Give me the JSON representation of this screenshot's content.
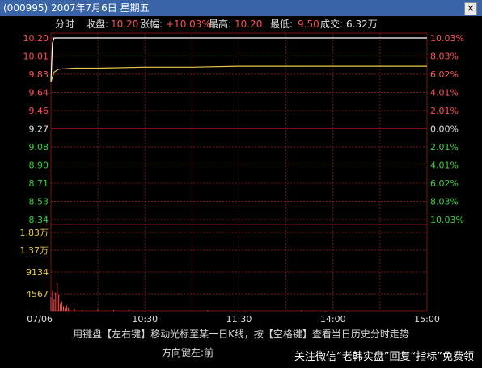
{
  "window": {
    "title": "(000995) 2007年7月6日 星期五",
    "close_label": "×"
  },
  "info": {
    "mode": "分时",
    "close_label": "收盘:",
    "close_value": "10.20",
    "change_label": "涨幅:",
    "change_value": "+10.03%",
    "high_label": "最高:",
    "high_value": "10.20",
    "low_label": "最低:",
    "low_value": "9.50",
    "volume_label": "成交:",
    "volume_value": "6.32万"
  },
  "price_axis": {
    "labels": [
      "10.20",
      "10.01",
      "9.83",
      "9.64",
      "9.46",
      "9.27",
      "9.08",
      "8.90",
      "8.71",
      "8.53",
      "8.34"
    ],
    "pct_labels": [
      "10.03%",
      "8.03%",
      "6.02%",
      "4.01%",
      "2.01%",
      "0.00%",
      "2.01%",
      "4.01%",
      "6.02%",
      "8.03%",
      "10.03%"
    ]
  },
  "volume_axis": {
    "labels": [
      "1.83万",
      "1.37万",
      "9134",
      "4567"
    ]
  },
  "time_axis": {
    "labels": [
      "07/06",
      "10:30",
      "11:30",
      "14:00",
      "15:00"
    ]
  },
  "hint": "用键盘【左右键】移动光标至某一日K线，按【空格键】查看当日历史分时走势",
  "footer": "方向键左:前",
  "watermark": "关注微信“老韩实盘”回复“指标”免费领",
  "colors": {
    "up": "#ff5050",
    "down": "#3cd23c",
    "neutral": "#e0e0e0",
    "price_line": "#ffffff",
    "avg_line": "#e8c84a",
    "grid": "#7a1414"
  },
  "chart_data": [
    {
      "type": "line",
      "prev_close": 9.27,
      "ylim": [
        8.34,
        10.2
      ],
      "x": [
        "09:30",
        "09:31",
        "09:32",
        "09:35",
        "09:45",
        "10:00",
        "10:30",
        "11:00",
        "11:30",
        "13:30",
        "14:00",
        "14:30",
        "15:00"
      ],
      "series": [
        {
          "values": [
            9.75,
            10.15,
            10.2,
            10.2,
            10.2,
            10.2,
            10.2,
            10.2,
            10.2,
            10.2,
            10.2,
            10.2,
            10.2
          ]
        },
        {
          "values": [
            9.75,
            9.8,
            9.85,
            9.88,
            9.89,
            9.89,
            9.9,
            9.9,
            9.91,
            9.91,
            9.91,
            9.91,
            9.91
          ]
        }
      ]
    },
    {
      "type": "bar",
      "ylim": [
        0,
        18300
      ],
      "x": [
        "09:30",
        "09:31",
        "09:32",
        "09:33",
        "09:34",
        "09:35",
        "09:36",
        "09:37",
        "09:38",
        "09:39",
        "09:40",
        "09:41",
        "09:42",
        "09:45",
        "09:50",
        "10:00",
        "10:10",
        "10:20",
        "11:10",
        "13:40"
      ],
      "values": [
        3000,
        4500,
        2500,
        4000,
        6000,
        3500,
        1500,
        2000,
        1000,
        500,
        1200,
        600,
        300,
        400,
        200,
        300,
        200,
        250,
        150,
        150
      ]
    }
  ]
}
